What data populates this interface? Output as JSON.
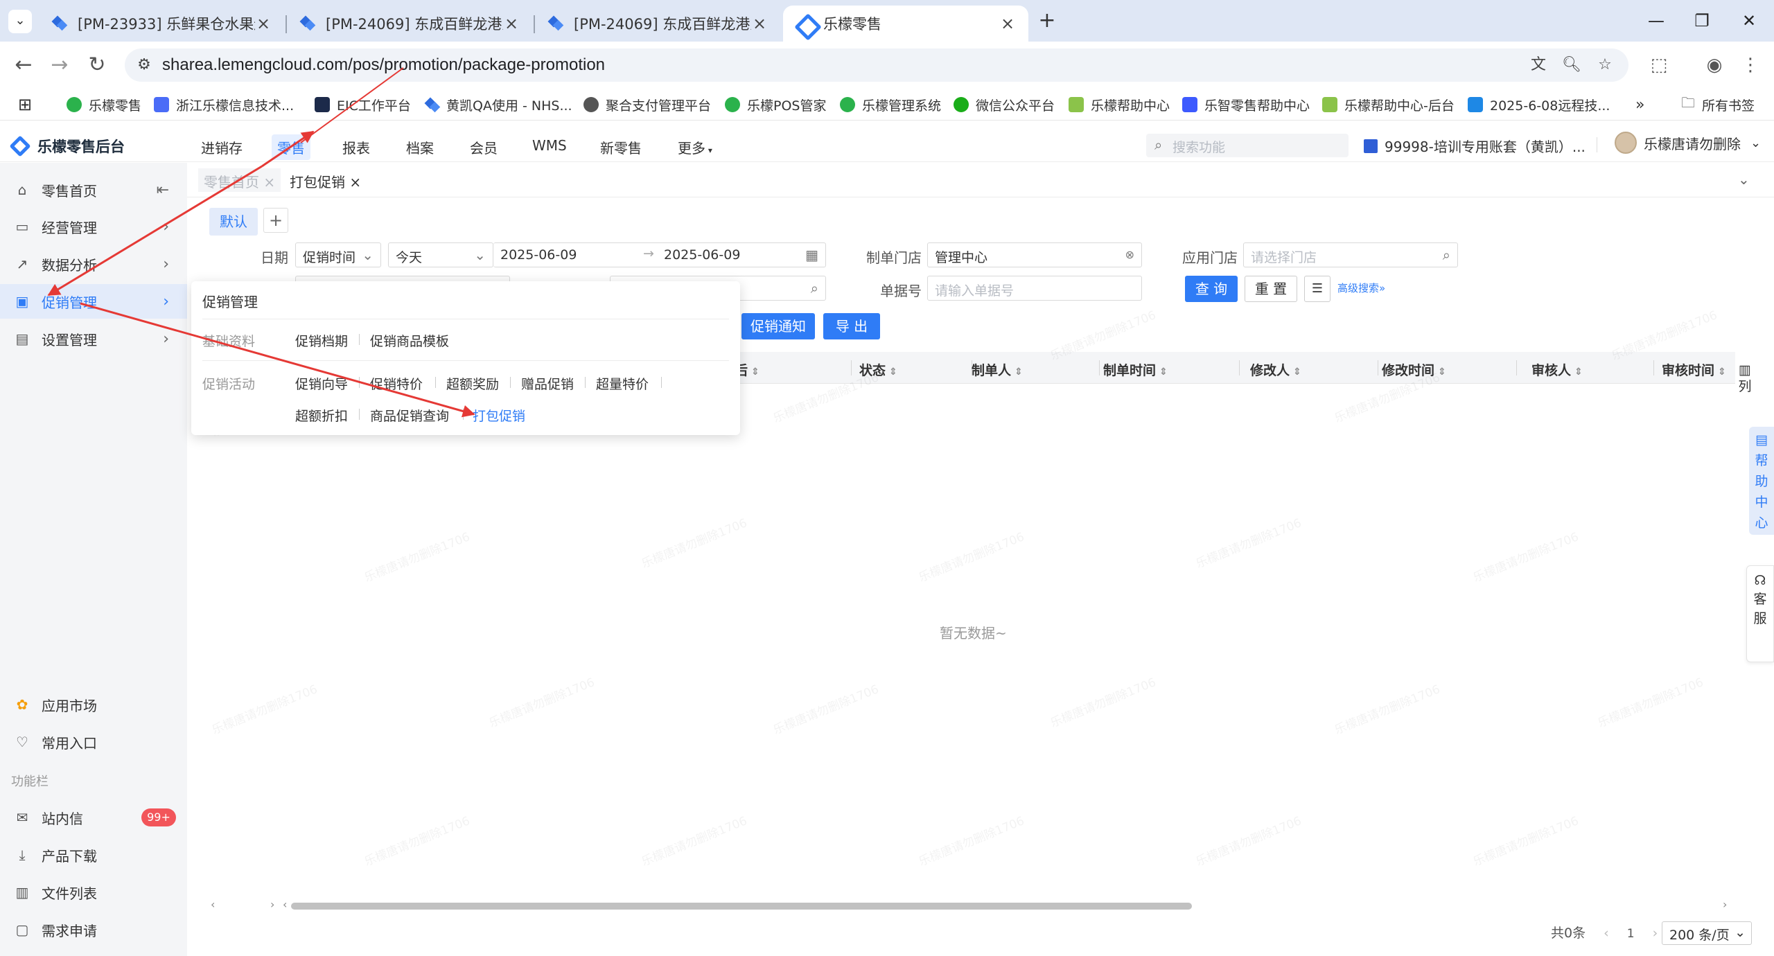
{
  "browser": {
    "tabs": [
      {
        "title": "[PM-23933] 乐鲜果仓水果连锁",
        "active": false
      },
      {
        "title": "[PM-24069] 东成百鲜龙港人民",
        "active": false
      },
      {
        "title": "[PM-24069] 东成百鲜龙港人民",
        "active": false
      },
      {
        "title": "乐檬零售",
        "active": true
      }
    ],
    "url": "sharea.lemengcloud.com/pos/promotion/package-promotion",
    "bookmarks": [
      {
        "label": "乐檬零售",
        "color": "#2bb24c"
      },
      {
        "label": "浙江乐檬信息技术...",
        "color": "#4a6cf7"
      },
      {
        "label": "EIC工作平台",
        "color": "#1c2a4a"
      },
      {
        "label": "黄凯QA使用 - NHS...",
        "color": "#2d6bde"
      },
      {
        "label": "聚合支付管理平台",
        "color": "#555555"
      },
      {
        "label": "乐檬POS管家",
        "color": "#2bb24c"
      },
      {
        "label": "乐檬管理系统",
        "color": "#2bb24c"
      },
      {
        "label": "微信公众平台",
        "color": "#1aad19"
      },
      {
        "label": "乐檬帮助中心",
        "color": "#8bc34a"
      },
      {
        "label": "乐智零售帮助中心",
        "color": "#3d5afe"
      },
      {
        "label": "乐檬帮助中心-后台",
        "color": "#8bc34a"
      },
      {
        "label": "2025-6-08远程技...",
        "color": "#1e88e5"
      }
    ],
    "all_bookmarks": "所有书签"
  },
  "app": {
    "logo": "乐檬零售后台",
    "topnav": [
      "进销存",
      "零售",
      "报表",
      "档案",
      "会员",
      "WMS",
      "新零售",
      "更多"
    ],
    "topnav_active": "零售",
    "search_placeholder": "搜索功能",
    "account": "99998-培训专用账套（黄凯）...",
    "user": "乐檬唐请勿删除"
  },
  "sidebar": {
    "items": [
      {
        "label": "零售首页",
        "icon": "home-icon"
      },
      {
        "label": "经营管理",
        "icon": "chart-icon"
      },
      {
        "label": "数据分析",
        "icon": "trend-icon"
      },
      {
        "label": "促销管理",
        "icon": "promo-icon"
      },
      {
        "label": "设置管理",
        "icon": "settings-icon"
      }
    ],
    "bottom": [
      {
        "label": "应用市场",
        "icon": "app-market-icon"
      },
      {
        "label": "常用入口",
        "icon": "heart-icon"
      }
    ],
    "section_title": "功能栏",
    "func": [
      {
        "label": "站内信",
        "icon": "mail-icon"
      },
      {
        "label": "产品下载",
        "icon": "download-icon"
      },
      {
        "label": "文件列表",
        "icon": "file-icon"
      },
      {
        "label": "需求申请",
        "icon": "request-icon"
      }
    ],
    "badge": "99+"
  },
  "page_tabs": [
    {
      "label": "零售首页 ×",
      "active": false
    },
    {
      "label": "打包促销 ×",
      "active": true
    }
  ],
  "filters": {
    "default_tab": "默认",
    "date_label": "日期",
    "date_type": "促销时间",
    "date_range": "今天",
    "date_start": "2025-06-09",
    "date_end": "2025-06-09",
    "maker_store_label": "制单门店",
    "maker_store_value": "管理中心",
    "apply_store_label": "应用门店",
    "apply_store_placeholder": "请选择门店",
    "doc_no_label": "单据号",
    "doc_no_placeholder": "请输入单据号",
    "query": "查 询",
    "reset": "重 置",
    "advanced": "高级搜索",
    "notify": "促销通知",
    "export": "导 出"
  },
  "table": {
    "columns": [
      "状态",
      "制单人",
      "制单时间",
      "修改人",
      "修改时间",
      "审核人",
      "审核时间"
    ],
    "partial_col_tail": "后",
    "settings": "列",
    "empty": "暂无数据~"
  },
  "pager": {
    "total": "共0条",
    "page": "1",
    "size": "200 条/页"
  },
  "float": {
    "help": "帮助中心",
    "service": "客服"
  },
  "menu": {
    "title": "促销管理",
    "basic_label": "基础资料",
    "basic": [
      "促销档期",
      "促销商品模板"
    ],
    "activity_label": "促销活动",
    "activity_row1": [
      "促销向导",
      "促销特价",
      "超额奖励",
      "赠品促销",
      "超量特价"
    ],
    "activity_row2": [
      "超额折扣",
      "商品促销查询",
      "打包促销"
    ]
  },
  "watermark": "乐檬唐请勿删除1706",
  "colors": {
    "primary": "#2f7cf6",
    "annotation": "#e53935",
    "badge": "#f2555a"
  }
}
